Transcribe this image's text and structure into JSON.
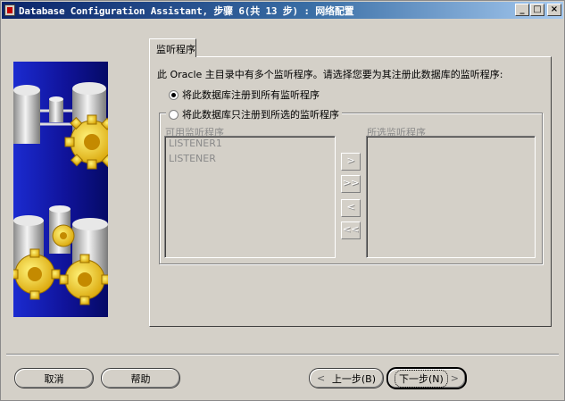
{
  "window": {
    "title": "Database Configuration Assistant, 步骤 6(共 13 步) : 网络配置",
    "controls": {
      "minimize": "_",
      "maximize": "□",
      "close": "×"
    }
  },
  "tab": {
    "label": "监听程序"
  },
  "description": "此 Oracle 主目录中有多个监听程序。请选择您要为其注册此数据库的监听程序:",
  "options": {
    "register_all": {
      "label": "将此数据库注册到所有监听程序",
      "selected": true
    },
    "register_selected": {
      "label": "将此数据库只注册到所选的监听程序",
      "selected": false
    }
  },
  "available": {
    "label": "可用监听程序",
    "items": [
      "LISTENER1",
      "LISTENER"
    ]
  },
  "selected_list": {
    "label": "所选监听程序",
    "items": []
  },
  "move_buttons": {
    "move_right": ">",
    "move_all_right": ">>",
    "move_left": "<",
    "move_all_left": "<<"
  },
  "footer": {
    "cancel": "取消",
    "help": "帮助",
    "back_arrow": "<",
    "back": "上一步(B)",
    "next": "下一步(N)",
    "next_arrow": ">"
  }
}
